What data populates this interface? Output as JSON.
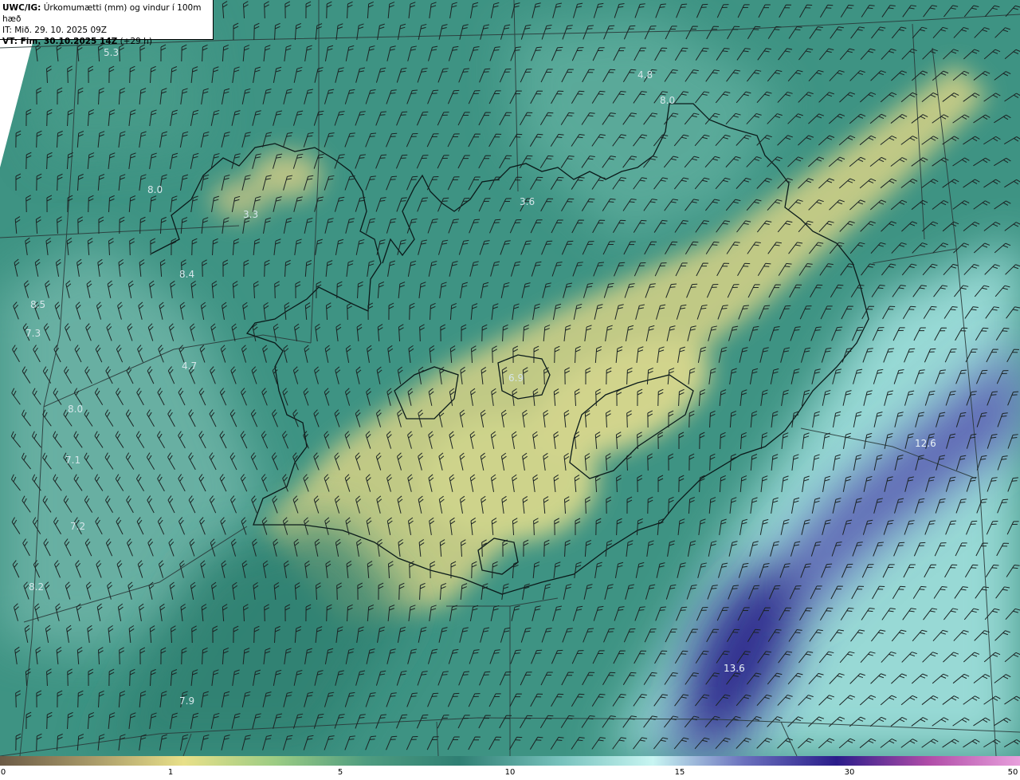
{
  "header": {
    "model": "UWC/IG:",
    "title_rest": " Úrkomumætti (mm) og vindur í 100m hæð",
    "initial_time": "IT: Mið. 29. 10. 2025 09Z",
    "valid_prefix": "VT:",
    "valid_bold": " Fim. 30.10.2025 14Z",
    "valid_suffix": " (+29 h)"
  },
  "map_values": [
    "5.3",
    "4.8",
    "8.0",
    "8.0",
    "3.3",
    "3.6",
    "8.4",
    "8.5",
    "7.3",
    "4.7",
    "6.9",
    "8.0",
    "7.1",
    "7.2",
    "8.2",
    "12.6",
    "13.6",
    "7.9"
  ],
  "colorbar": {
    "labels": [
      "0",
      "1",
      "5",
      "10",
      "15",
      "30",
      "50"
    ],
    "colors": [
      "#6b5a45",
      "#a89968",
      "#e8e089",
      "#9ccc84",
      "#4e9c80",
      "#2f7f73",
      "#78c2bd",
      "#c8f5f2",
      "#6a70bd",
      "#2a1c8a",
      "#b04ca8",
      "#e8a0dc"
    ]
  },
  "map_colors": {
    "base_sea": "#3e9383",
    "highland": "#d8d68a",
    "high_precip": "#5a5fb0",
    "light": "#b2ecea"
  }
}
